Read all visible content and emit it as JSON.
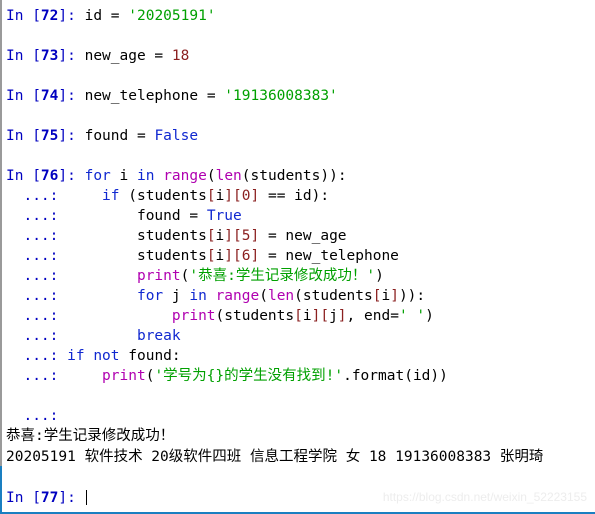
{
  "console": {
    "prompt_label": "In",
    "continuation": "...:",
    "cursor": "text-cursor",
    "cells": [
      {
        "prompt": "In [72]:",
        "number": "72",
        "code": "id = '20205191'"
      },
      {
        "prompt": "In [73]:",
        "number": "73",
        "code": "new_age = 18"
      },
      {
        "prompt": "In [74]:",
        "number": "74",
        "code": "new_telephone = '19136008383'"
      },
      {
        "prompt": "In [75]:",
        "number": "75",
        "code": "found = False"
      },
      {
        "prompt": "In [76]:",
        "number": "76",
        "code": "for i in range(len(students)):"
      },
      {
        "prompt": "In [77]:",
        "number": "77",
        "code": ""
      }
    ],
    "block_lines": [
      "    if (students[i][0] == id):",
      "        found = True",
      "        students[i][5] = new_age",
      "        students[i][6] = new_telephone",
      "        print('恭喜:学生记录修改成功！')",
      "        for j in range(len(students[i])):",
      "            print(students[i][j], end=' ')",
      "        break",
      "if not found:",
      "    print('学号为{}的学生没有找到!'.format(id))",
      ""
    ],
    "output": [
      "恭喜:学生记录修改成功！",
      "20205191 软件技术 20级软件四班 信息工程学院 女 18 19136008383 张明琦 "
    ]
  },
  "watermark": {
    "text": "https://blog.csdn.net/weixin_52223155"
  },
  "colors": {
    "keyword": "#1028d0",
    "builtin": "#b000b0",
    "string": "#00a000",
    "number": "#8b2020",
    "prompt": "#0000c0",
    "focus_border": "#1a7fc1",
    "gutter_border": "#9a9a9a"
  }
}
